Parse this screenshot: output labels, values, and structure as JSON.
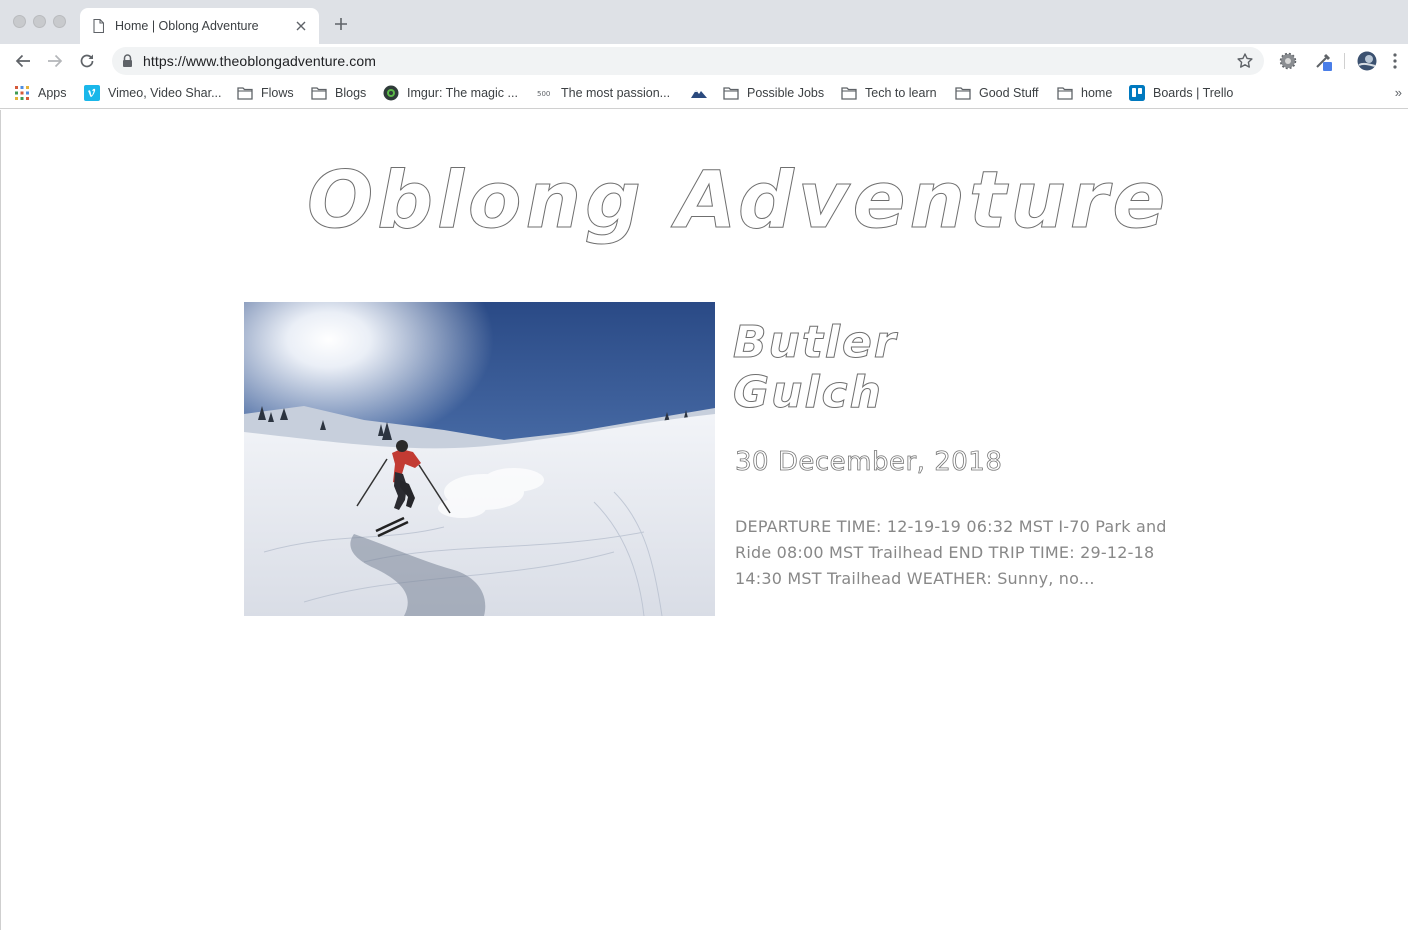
{
  "browser": {
    "tab_title": "Home | Oblong Adventure",
    "url": "https://www.theoblongadventure.com",
    "bookmarks": [
      {
        "label": "Apps",
        "icon": "apps-grid-icon"
      },
      {
        "label": "Vimeo, Video Shar...",
        "icon": "vimeo-icon"
      },
      {
        "label": "Flows",
        "icon": "folder-icon"
      },
      {
        "label": "Blogs",
        "icon": "folder-icon"
      },
      {
        "label": "Imgur: The magic ...",
        "icon": "imgur-icon"
      },
      {
        "label": "The most passion...",
        "icon": "site-icon"
      },
      {
        "label": "",
        "icon": "mountain-icon"
      },
      {
        "label": "Possible Jobs",
        "icon": "folder-icon"
      },
      {
        "label": "Tech to learn",
        "icon": "folder-icon"
      },
      {
        "label": "Good Stuff",
        "icon": "folder-icon"
      },
      {
        "label": "home",
        "icon": "folder-icon"
      },
      {
        "label": "Boards | Trello",
        "icon": "trello-icon"
      }
    ],
    "more_bookmarks": "»"
  },
  "page": {
    "site_title": "Oblong Adventure",
    "post": {
      "title": "Butler Gulch",
      "date": "30 December, 2018",
      "excerpt": "DEPARTURE TIME: 12-19-19 06:32 MST I-70 Park and Ride 08:00 MST Trailhead END TRIP TIME: 29-12-18 14:30 MST Trailhead WEATHER: Sunny, no..."
    }
  },
  "colors": {
    "tabstrip": "#dee1e6",
    "omnibox": "#f1f3f4",
    "outline_text": "#6f6f6f",
    "body_text": "#888888"
  }
}
